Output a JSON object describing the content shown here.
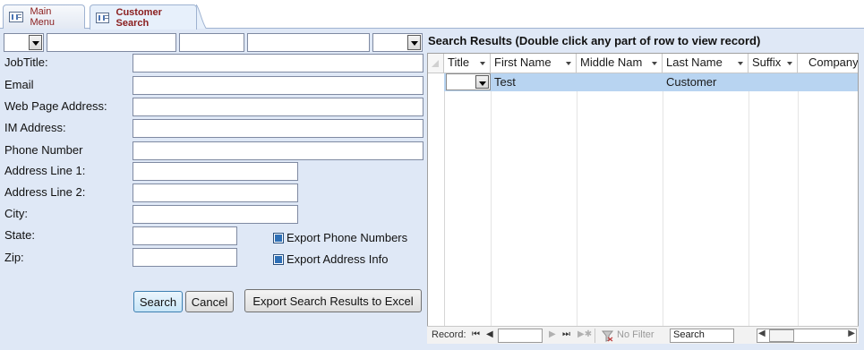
{
  "tabs": [
    {
      "label": "Main Menu",
      "active": false
    },
    {
      "label": "Customer Search",
      "active": true
    }
  ],
  "search_form": {
    "fields": [
      {
        "label": "JobTitle:",
        "value": ""
      },
      {
        "label": "Email",
        "value": ""
      },
      {
        "label": "Web Page Address:",
        "value": ""
      },
      {
        "label": "IM Address:",
        "value": ""
      },
      {
        "label": "Phone Number",
        "value": ""
      },
      {
        "label": "Address Line 1:",
        "value": ""
      },
      {
        "label": "Address Line 2:",
        "value": ""
      },
      {
        "label": "City:",
        "value": ""
      },
      {
        "label": "State:",
        "value": ""
      },
      {
        "label": "Zip:",
        "value": ""
      }
    ],
    "export_phone_label": "Export Phone Numbers",
    "export_address_label": "Export Address Info",
    "search_button": "Search",
    "cancel_button": "Cancel",
    "export_button": "Export Search Results to Excel"
  },
  "results": {
    "heading": "Search Results (Double click any part of row to view record)",
    "columns": [
      "Title",
      "First Name",
      "Middle Nam",
      "Last Name",
      "Suffix",
      "Company"
    ],
    "rows": [
      [
        "",
        "Test",
        "",
        "Customer",
        "",
        ""
      ]
    ]
  },
  "navigation": {
    "record_label": "Record:",
    "record_value": "",
    "filter_label": "No Filter",
    "search_placeholder": "Search"
  },
  "colors": {
    "form_background": "#dfe8f6",
    "tab_text": "#8a1d1d",
    "selected_row": "#b8d4f1"
  }
}
